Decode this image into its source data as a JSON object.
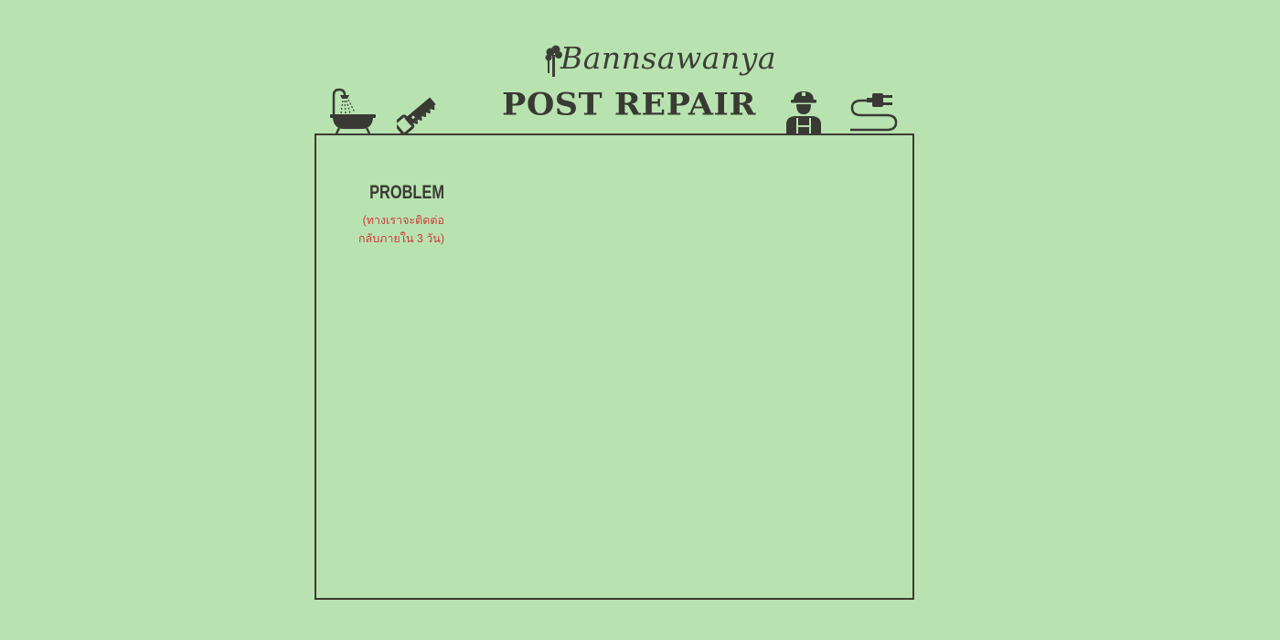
{
  "brand": {
    "name": "Bannsawanya"
  },
  "header": {
    "title": "POST REPAIR",
    "icons": [
      "bathtub-icon",
      "saw-icon",
      "worker-icon",
      "plug-icon"
    ]
  },
  "form": {
    "problem_label": "PROBLEM",
    "problem_hint_line1": "(ทางเราจะติดต่อ",
    "problem_hint_line2": "กลับภายใน 3 วัน)"
  },
  "colors": {
    "background": "#b8e3b0",
    "text": "#3a3a34",
    "hint": "#d03a3a",
    "border": "#3c3c36"
  }
}
